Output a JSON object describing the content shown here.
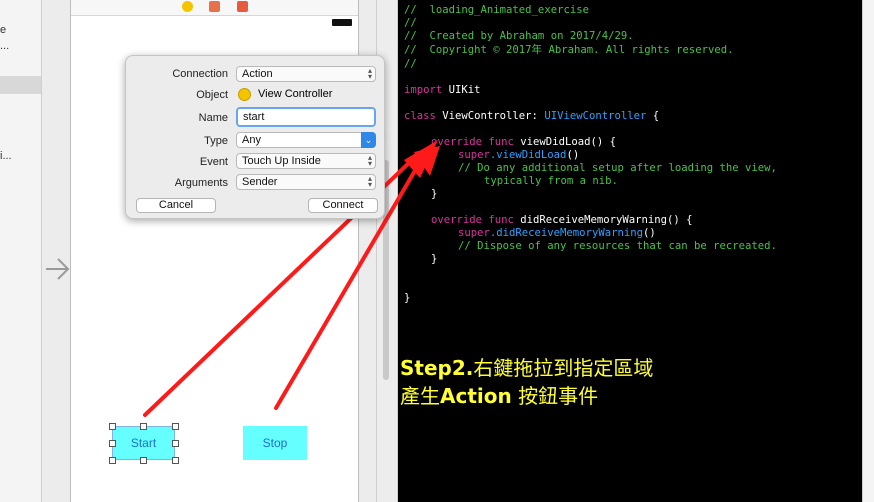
{
  "navigator": {
    "frag1": "e",
    "frag2": "...",
    "frag3": "i..."
  },
  "scene": {
    "start_button": "Start",
    "stop_button": "Stop"
  },
  "popover": {
    "connection_label": "Connection",
    "connection_value": "Action",
    "object_label": "Object",
    "object_value": "View Controller",
    "name_label": "Name",
    "name_value": "start",
    "type_label": "Type",
    "type_value": "Any",
    "event_label": "Event",
    "event_value": "Touch Up Inside",
    "arguments_label": "Arguments",
    "arguments_value": "Sender",
    "cancel_button": "Cancel",
    "connect_button": "Connect"
  },
  "code": {
    "l1": "//  loading_Animated_exercise",
    "l2": "//",
    "l3": "//  Created by Abraham on 2017/4/29.",
    "l4": "//  Copyright © 2017年 Abraham. All rights reserved.",
    "l5": "//",
    "import_kw": "import",
    "import_mod": " UIKit",
    "class_kw": "class",
    "class_name": " ViewController: ",
    "class_super": "UIViewController",
    "class_brace": " {",
    "override1": "override func",
    "func1": " viewDidLoad() {",
    "super1_kw": "super",
    "super1_call": ".viewDidLoad",
    "super1_end": "()",
    "cm1": "// Do any additional setup after loading the view,",
    "cm1b": "typically from a nib.",
    "close1": "}",
    "override2": "override func",
    "func2": " didReceiveMemoryWarning() {",
    "super2_kw": "super",
    "super2_call": ".didReceiveMemoryWarning",
    "super2_end": "()",
    "cm2": "// Dispose of any resources that can be recreated.",
    "close2": "}",
    "close3": "}"
  },
  "annotation": {
    "line1_bold": "Step2.",
    "line1_rest": "右鍵拖拉到指定區域",
    "line2_pre": "產生",
    "line2_bold": "Action",
    "line2_rest": " 按鈕事件"
  },
  "colors": {
    "arrow": "#ff1a1a",
    "annotation": "#ffff33",
    "button_fill": "#66ffff",
    "comment": "#48c24a",
    "keyword": "#d9329f",
    "type": "#2fa0ff"
  },
  "icons": [
    "entry-arrow-icon",
    "object-controller-icon",
    "chevron-updown-icon",
    "dropdown-arrow-icon"
  ]
}
